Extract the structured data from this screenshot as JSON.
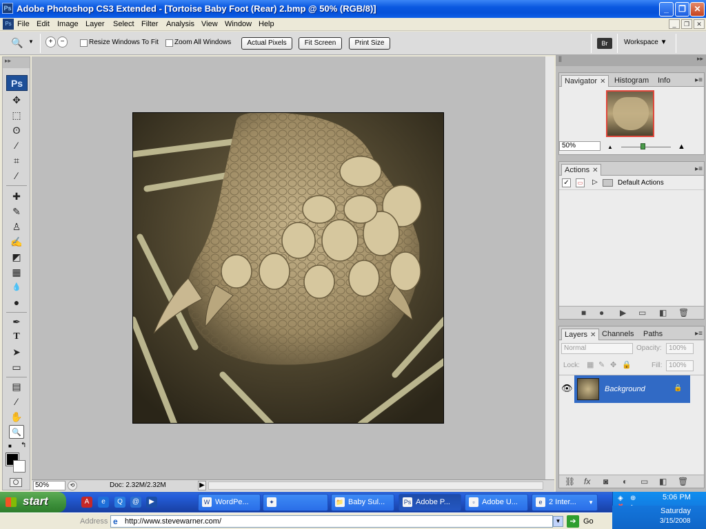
{
  "window": {
    "title": "Adobe Photoshop CS3 Extended - [Tortoise Baby Foot (Rear) 2.bmp @ 50% (RGB/8)]",
    "app_icon": "Ps",
    "buttons": {
      "minimize": "_",
      "maximize": "❐",
      "close": "✕"
    }
  },
  "menubar": {
    "items": [
      "File",
      "Edit",
      "Image",
      "Layer",
      "Select",
      "Filter",
      "Analysis",
      "View",
      "Window",
      "Help"
    ],
    "doc_controls": [
      "_",
      "❐",
      "✕"
    ]
  },
  "options_bar": {
    "resize_windows": "Resize Windows To Fit",
    "zoom_all": "Zoom All Windows",
    "actual_pixels": "Actual Pixels",
    "fit_screen": "Fit Screen",
    "print_size": "Print Size",
    "workspace": "Workspace ▼",
    "bridge_icon": "Br"
  },
  "toolbox": {
    "logo": "Ps",
    "tools": [
      {
        "name": "move-tool",
        "glyph": "✥"
      },
      {
        "name": "marquee-tool",
        "glyph": "⬚"
      },
      {
        "name": "lasso-tool",
        "glyph": "ʘ"
      },
      {
        "name": "magic-wand-tool",
        "glyph": "⁄"
      },
      {
        "name": "crop-tool",
        "glyph": "⌗"
      },
      {
        "name": "slice-tool",
        "glyph": "∕"
      },
      {
        "name": "healing-brush-tool",
        "glyph": "✚"
      },
      {
        "name": "brush-tool",
        "glyph": "✎"
      },
      {
        "name": "clone-stamp-tool",
        "glyph": "♙"
      },
      {
        "name": "history-brush-tool",
        "glyph": "✍"
      },
      {
        "name": "eraser-tool",
        "glyph": "◩"
      },
      {
        "name": "gradient-tool",
        "glyph": "▦"
      },
      {
        "name": "blur-tool",
        "glyph": "💧"
      },
      {
        "name": "dodge-tool",
        "glyph": "●"
      },
      {
        "name": "pen-tool",
        "glyph": "✒"
      },
      {
        "name": "type-tool",
        "glyph": "T"
      },
      {
        "name": "path-selection-tool",
        "glyph": "➤"
      },
      {
        "name": "shape-tool",
        "glyph": "▭"
      },
      {
        "name": "notes-tool",
        "glyph": "▤"
      },
      {
        "name": "eyedropper-tool",
        "glyph": "⁄"
      },
      {
        "name": "hand-tool",
        "glyph": "✋"
      },
      {
        "name": "zoom-tool",
        "glyph": "🔍"
      }
    ]
  },
  "status_bar": {
    "zoom": "50%",
    "doc_info": "Doc: 2.32M/2.32M"
  },
  "navigator_panel": {
    "tabs": [
      "Navigator",
      "Histogram",
      "Info"
    ],
    "zoom": "50%"
  },
  "actions_panel": {
    "tab": "Actions",
    "item": "Default Actions"
  },
  "layers_panel": {
    "tabs": [
      "Layers",
      "Channels",
      "Paths"
    ],
    "blend_mode": "Normal",
    "opacity_label": "Opacity:",
    "opacity_value": "100%",
    "lock_label": "Lock:",
    "fill_label": "Fill:",
    "fill_value": "100%",
    "layer_name": "Background"
  },
  "taskbar": {
    "start": "start",
    "buttons": [
      {
        "label": "WordPe...",
        "icon": "W"
      },
      {
        "label": "",
        "icon": "✦"
      },
      {
        "label": "Baby Sul...",
        "icon": "📁"
      },
      {
        "label": "Adobe P...",
        "icon": "Ps"
      },
      {
        "label": "Adobe U...",
        "icon": "▫"
      },
      {
        "label": "2 Inter...",
        "icon": "e"
      }
    ],
    "time": "5:06 PM",
    "day": "Saturday",
    "date": "3/15/2008"
  },
  "address_bar": {
    "label": "Address",
    "url": "http://www.stevewarner.com/",
    "go": "Go"
  },
  "colors": {
    "xp_blue": "#0a58e0",
    "ps_panel_gray": "#ececec",
    "selected_layer": "#316ac5",
    "navigator_frame": "#e0463a"
  }
}
